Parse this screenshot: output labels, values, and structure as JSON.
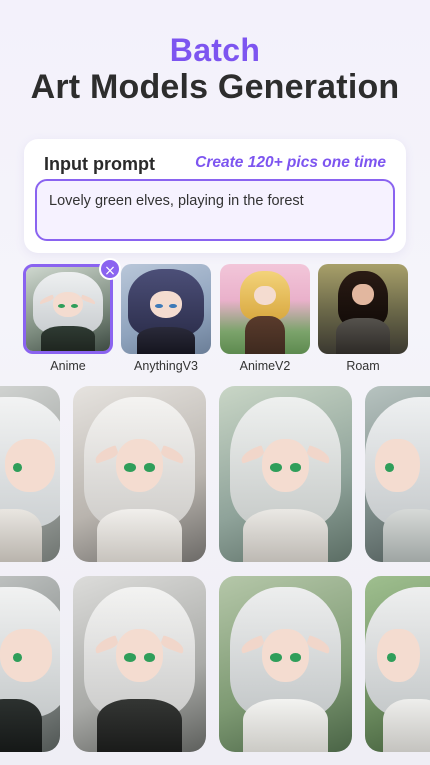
{
  "header": {
    "accent": "Batch",
    "title": "Art Models Generation"
  },
  "prompt": {
    "label": "Input prompt",
    "hint": "Create 120+ pics one time",
    "value": "Lovely green elves, playing in the forest"
  },
  "models": [
    {
      "label": "Anime",
      "selected": true
    },
    {
      "label": "AnythingV3",
      "selected": false
    },
    {
      "label": "AnimeV2",
      "selected": false
    },
    {
      "label": "Roam",
      "selected": false
    }
  ],
  "icons": {
    "close": "×"
  },
  "colors": {
    "accent": "#7d55f0",
    "border": "#8a63f0",
    "eyes": "#2f9e5a"
  },
  "gallery": {
    "rows": 2,
    "subject": "white-haired elf girl with green eyes"
  }
}
